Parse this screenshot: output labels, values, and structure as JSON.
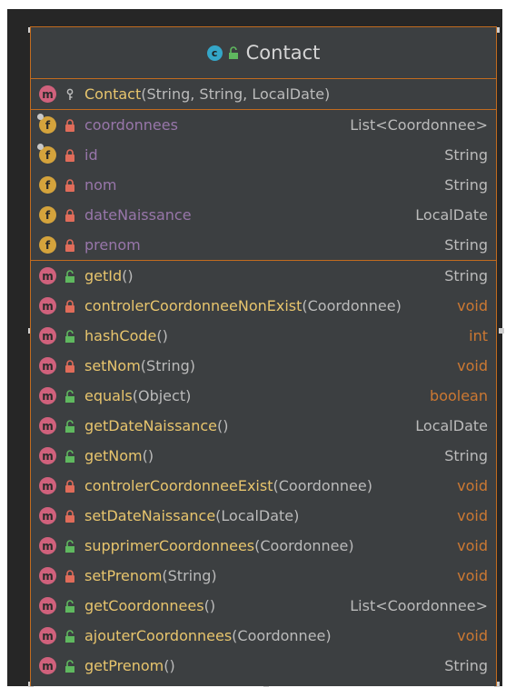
{
  "class": {
    "name": "Contact",
    "badge": "c",
    "icon": "class-icon"
  },
  "constructors": [
    {
      "name": "Contact",
      "params": "(String, String, LocalDate)",
      "visibility": "package"
    }
  ],
  "fields": [
    {
      "name": "coordonnees",
      "type": "List<Coordonnee>",
      "visibility": "private",
      "pinned": true
    },
    {
      "name": "id",
      "type": "String",
      "visibility": "private",
      "pinned": true
    },
    {
      "name": "nom",
      "type": "String",
      "visibility": "private",
      "pinned": false
    },
    {
      "name": "dateNaissance",
      "type": "LocalDate",
      "visibility": "private",
      "pinned": false
    },
    {
      "name": "prenom",
      "type": "String",
      "visibility": "private",
      "pinned": false
    }
  ],
  "methods": [
    {
      "name": "getId",
      "params": "()",
      "type": "String",
      "visibility": "public",
      "primitive": false
    },
    {
      "name": "controlerCoordonneeNonExist",
      "params": "(Coordonnee)",
      "type": "void",
      "visibility": "private",
      "primitive": true
    },
    {
      "name": "hashCode",
      "params": "()",
      "type": "int",
      "visibility": "public",
      "primitive": true
    },
    {
      "name": "setNom",
      "params": "(String)",
      "type": "void",
      "visibility": "private",
      "primitive": true
    },
    {
      "name": "equals",
      "params": "(Object)",
      "type": "boolean",
      "visibility": "public",
      "primitive": true
    },
    {
      "name": "getDateNaissance",
      "params": "()",
      "type": "LocalDate",
      "visibility": "public",
      "primitive": false
    },
    {
      "name": "getNom",
      "params": "()",
      "type": "String",
      "visibility": "public",
      "primitive": false
    },
    {
      "name": "controlerCoordonneeExist",
      "params": "(Coordonnee)",
      "type": "void",
      "visibility": "private",
      "primitive": true
    },
    {
      "name": "setDateNaissance",
      "params": "(LocalDate)",
      "type": "void",
      "visibility": "private",
      "primitive": true
    },
    {
      "name": "supprimerCoordonnees",
      "params": "(Coordonnee)",
      "type": "void",
      "visibility": "public",
      "primitive": true
    },
    {
      "name": "setPrenom",
      "params": "(String)",
      "type": "void",
      "visibility": "private",
      "primitive": true
    },
    {
      "name": "getCoordonnees",
      "params": "()",
      "type": "List<Coordonnee>",
      "visibility": "public",
      "primitive": false
    },
    {
      "name": "ajouterCoordonnees",
      "params": "(Coordonnee)",
      "type": "void",
      "visibility": "public",
      "primitive": true
    },
    {
      "name": "getPrenom",
      "params": "()",
      "type": "String",
      "visibility": "public",
      "primitive": false
    }
  ],
  "colors": {
    "border": "#c26b1f",
    "method_name": "#e8c56d",
    "field_name": "#9876aa",
    "primitive_type": "#cc7832",
    "ref_type": "#bbbbbb",
    "public_lock": "#5fb85f",
    "private_lock": "#e06c5a"
  }
}
